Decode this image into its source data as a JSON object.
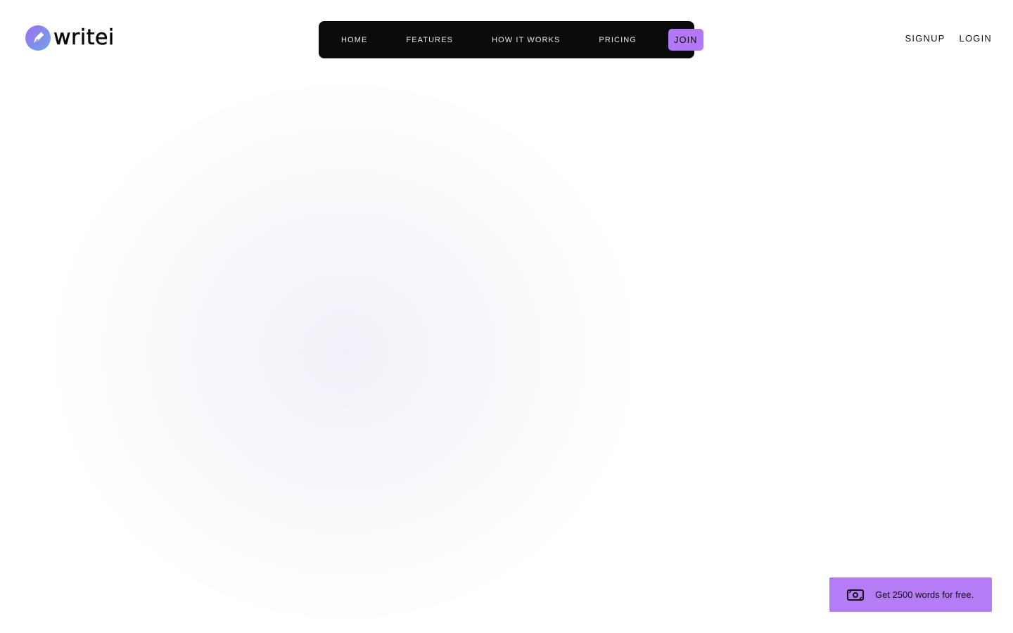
{
  "brand": {
    "name": "writei",
    "accent": "#b278f5",
    "logo_gradient": [
      "#9a6cf0",
      "#6f9ee8"
    ]
  },
  "nav": {
    "items": [
      {
        "label": "HOME"
      },
      {
        "label": "FEATURES"
      },
      {
        "label": "HOW IT WORKS"
      },
      {
        "label": "PRICING"
      }
    ],
    "cta_label": "JOIN",
    "background": "#0b0b0d"
  },
  "auth": {
    "signup_label": "SIGNUP",
    "login_label": "LOGIN"
  },
  "promo": {
    "icon": "cash-icon",
    "text": "Get 2500 words for free."
  }
}
